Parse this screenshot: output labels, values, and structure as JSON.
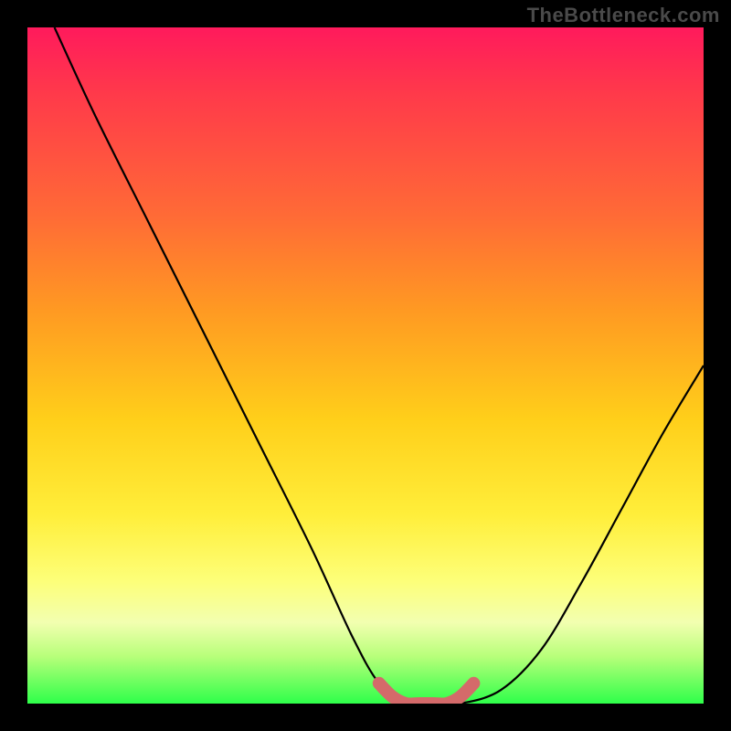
{
  "watermark": "TheBottleneck.com",
  "chart_data": {
    "type": "line",
    "title": "",
    "xlabel": "",
    "ylabel": "",
    "xlim": [
      0,
      100
    ],
    "ylim": [
      0,
      100
    ],
    "grid": false,
    "legend": false,
    "background_gradient": [
      "#ff1a5c",
      "#ff6b36",
      "#ffcf1a",
      "#fdff7a",
      "#2eff4a"
    ],
    "series": [
      {
        "name": "bottleneck-curve",
        "color": "#000000",
        "x": [
          4,
          10,
          18,
          26,
          34,
          42,
          48,
          52,
          56,
          60,
          64,
          70,
          76,
          82,
          88,
          94,
          100
        ],
        "y": [
          100,
          87,
          71,
          55,
          39,
          23,
          10,
          3,
          0,
          0,
          0,
          2,
          8,
          18,
          29,
          40,
          50
        ]
      },
      {
        "name": "optimal-band-marker",
        "color": "#d46a6a",
        "x": [
          52,
          54,
          56,
          58,
          60,
          62,
          64,
          66
        ],
        "y": [
          3,
          1,
          0,
          0,
          0,
          0,
          1,
          3
        ]
      }
    ],
    "annotations": []
  }
}
